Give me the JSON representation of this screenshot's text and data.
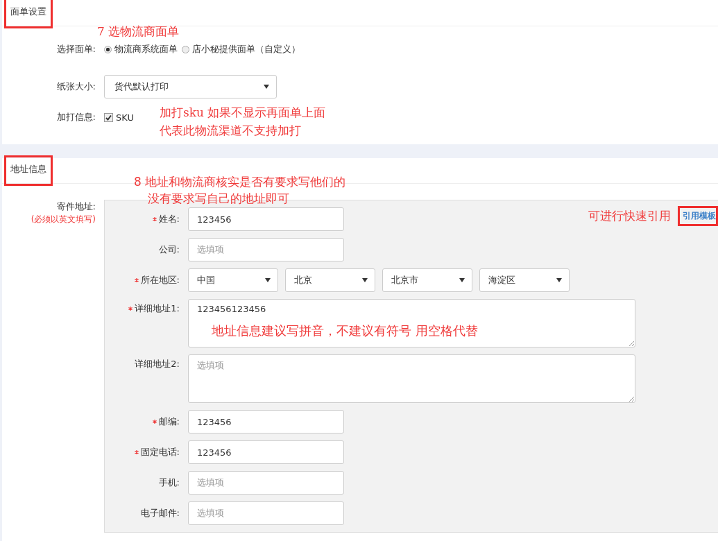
{
  "waybill_settings": {
    "title": "面单设置",
    "title_highlighted": true,
    "annotation": [
      "7  选物流商面单"
    ],
    "waybill_choice": {
      "label": "选择面单:",
      "options": [
        {
          "label": "物流商系统面单",
          "selected": true
        },
        {
          "label": "店小秘提供面单（自定义）",
          "selected": false
        }
      ]
    },
    "paper_size": {
      "label": "纸张大小:",
      "value": "货代默认打印"
    },
    "extra_print": {
      "label": "加打信息:",
      "options": [
        {
          "label": "SKU",
          "checked": true
        }
      ],
      "annotation": [
        "加打sku 如果不显示再面单上面",
        "代表此物流渠道不支持加打"
      ]
    }
  },
  "address_info": {
    "title": "地址信息",
    "title_highlighted": true,
    "annotation": [
      "8 地址和物流商核实是否有要求写他们的",
      "没有要求写自己的地址即可"
    ],
    "sender_label": "寄件地址:",
    "sender_note": "(必须以英文填写)",
    "template_link": {
      "label": "引用模板",
      "highlighted": true
    },
    "template_annotation": "可进行快速引用",
    "fields": [
      {
        "kind": "input",
        "label": "姓名:",
        "required": true,
        "value": "123456"
      },
      {
        "kind": "input",
        "label": "公司:",
        "required": false,
        "placeholder": "选填项"
      },
      {
        "kind": "selects",
        "label": "所在地区:",
        "required": true,
        "values": [
          "中国",
          "北京",
          "北京市",
          "海淀区"
        ]
      },
      {
        "kind": "textarea",
        "label": "详细地址1:",
        "required": true,
        "value": "123456123456",
        "annotation": "地址信息建议写拼音，不建议有符号 用空格代替"
      },
      {
        "kind": "textarea",
        "label": "详细地址2:",
        "required": false,
        "placeholder": "选填项"
      },
      {
        "kind": "input",
        "label": "邮编:",
        "required": true,
        "value": "123456"
      },
      {
        "kind": "input",
        "label": "固定电话:",
        "required": true,
        "value": "123456"
      },
      {
        "kind": "input",
        "label": "手机:",
        "required": false,
        "placeholder": "选填项"
      },
      {
        "kind": "input",
        "label": "电子邮件:",
        "required": false,
        "placeholder": "选填项"
      }
    ]
  }
}
